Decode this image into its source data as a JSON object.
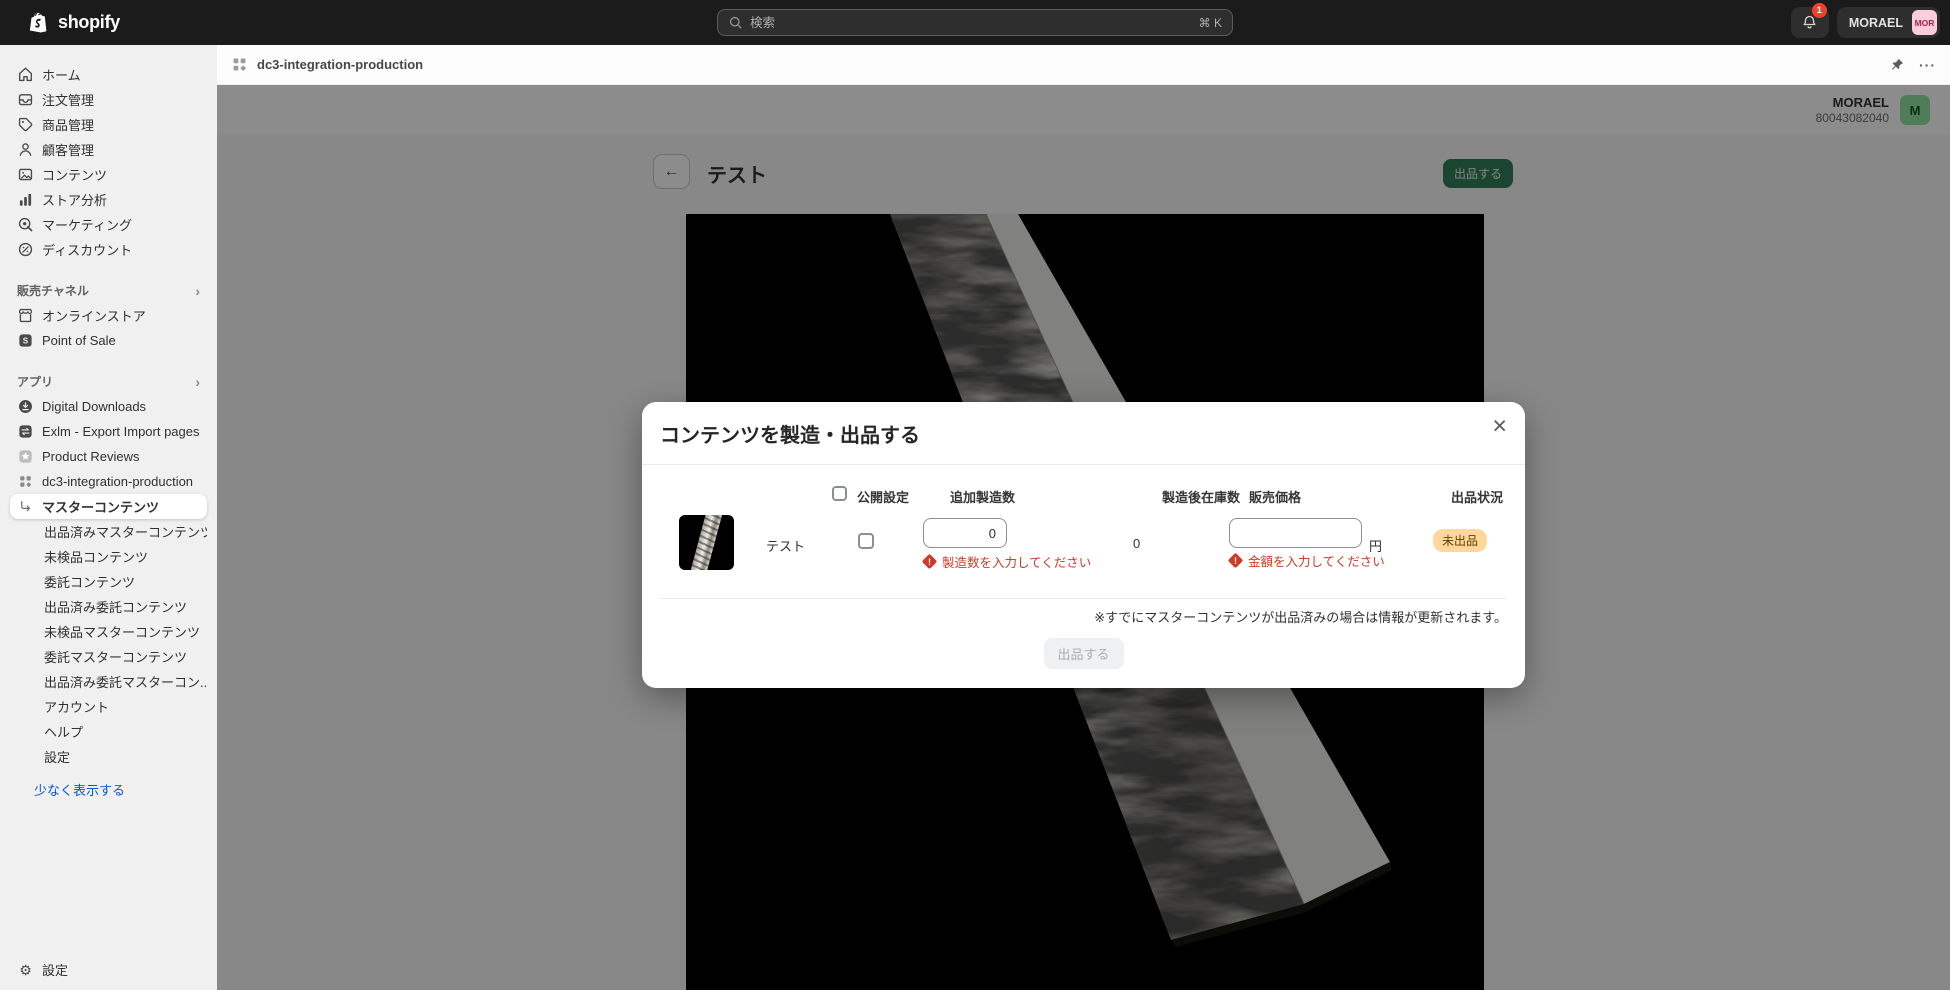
{
  "topbar": {
    "logo_text": "shopify",
    "search": {
      "placeholder": "検索",
      "shortcut": "⌘ K",
      "icon": "search-icon"
    },
    "notification": {
      "count": "1",
      "icon": "bell-icon"
    },
    "account": {
      "store_name": "MORAEL",
      "avatar_initials": "MOR"
    }
  },
  "appbar": {
    "breadcrumb": "dc3-integration-production",
    "icon": "app-grid-icon",
    "pin_icon": "pin-icon",
    "more_label": "···"
  },
  "sidebar": {
    "main": [
      {
        "label": "ホーム",
        "icon": "home-icon"
      },
      {
        "label": "注文管理",
        "icon": "orders-icon"
      },
      {
        "label": "商品管理",
        "icon": "products-icon"
      },
      {
        "label": "顧客管理",
        "icon": "customers-icon"
      },
      {
        "label": "コンテンツ",
        "icon": "content-icon"
      },
      {
        "label": "ストア分析",
        "icon": "analytics-icon"
      },
      {
        "label": "マーケティング",
        "icon": "marketing-icon"
      },
      {
        "label": "ディスカウント",
        "icon": "discount-icon"
      }
    ],
    "sales_channels": {
      "label": "販売チャネル",
      "items": [
        {
          "label": "オンラインストア",
          "icon": "online-store-icon"
        },
        {
          "label": "Point of Sale",
          "icon": "pos-icon"
        }
      ]
    },
    "apps": {
      "label": "アプリ",
      "items": [
        {
          "label": "Digital Downloads",
          "icon": "digital-downloads-icon"
        },
        {
          "label": "Exlm - Export Import pages",
          "icon": "exlm-icon"
        },
        {
          "label": "Product Reviews",
          "icon": "product-reviews-icon"
        },
        {
          "label": "dc3-integration-production",
          "icon": "app-grid-icon"
        }
      ]
    },
    "active_item": {
      "label": "マスターコンテンツ",
      "icon": "return-arrow-icon"
    },
    "sub_items": [
      "出品済みマスターコンテンツ",
      "未検品コンテンツ",
      "委託コンテンツ",
      "出品済み委託コンテンツ",
      "未検品マスターコンテンツ",
      "委託マスターコンテンツ",
      "出品済み委託マスターコン...",
      "アカウント",
      "ヘルプ",
      "設定"
    ],
    "show_less": "少なく表示する",
    "settings": {
      "label": "設定",
      "icon": "gear-icon"
    }
  },
  "page": {
    "store_name": "MORAEL",
    "store_id": "80043082040",
    "avatar_initial": "M",
    "title": "テスト",
    "publish_button": "出品する"
  },
  "modal": {
    "title": "コンテンツを製造・出品する",
    "close_label": "×",
    "columns": {
      "publish": "公開設定",
      "additional_qty": "追加製造数",
      "stock_after": "製造後在庫数",
      "price": "販売価格",
      "status": "出品状況"
    },
    "row": {
      "name": "テスト",
      "additional_qty_value": "0",
      "additional_qty_error": "製造数を入力してください",
      "stock_after_value": "0",
      "price_value": "",
      "price_unit": "円",
      "price_error": "金額を入力してください",
      "status": "未出品"
    },
    "note": "※すでにマスターコンテンツが出品済みの場合は情報が更新されます。",
    "submit_button": "出品する"
  },
  "colors": {
    "accent_green": "#2f7e5a",
    "error_red": "#cd3a28",
    "badge_bg": "#ffd79d",
    "badge_text": "#5e4200",
    "link_blue": "#005bd3"
  }
}
